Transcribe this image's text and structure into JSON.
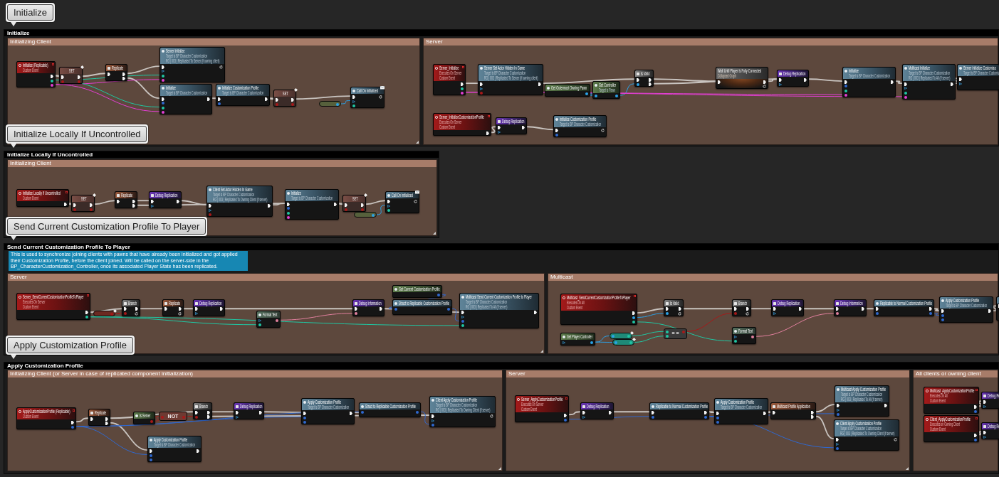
{
  "sections": [
    {
      "bookmark": "Initialize",
      "title": "Initialize",
      "groups": [
        {
          "title": "Initializing Client",
          "nodes": [
            {
              "kind": "event",
              "title": "Initialize (Replicable)",
              "lines": [
                "Custom Event"
              ],
              "out": [
                {
                  "kind": "exec"
                },
                {
                  "kind": "actor"
                },
                {
                  "kind": "string"
                }
              ]
            },
            {
              "kind": "set",
              "title": "SET",
              "replicated": true,
              "in": [
                {
                  "kind": "exec"
                },
                {
                  "kind": "bool"
                }
              ],
              "out": [
                {
                  "kind": "exec"
                },
                {
                  "kind": "bool"
                }
              ]
            },
            {
              "kind": "replicate",
              "title": "Replicate",
              "in": [
                {
                  "kind": "exec"
                }
              ],
              "out": [
                {
                  "kind": "exec"
                },
                {
                  "kind": "exec"
                }
              ]
            },
            {
              "kind": "function",
              "title": "Server Initialize",
              "lines": [
                "Target is BP Character Customization",
                "RG | 003 | Replicated To Server (if owning client)"
              ],
              "in": [
                {
                  "kind": "exec"
                },
                {
                  "kind": "self"
                },
                {
                  "kind": "actor"
                },
                {
                  "kind": "string"
                }
              ],
              "out": [
                {
                  "kind": "latent"
                }
              ]
            },
            {
              "kind": "function",
              "title": "Initialize",
              "lines": [
                "Target is BP Character Customization"
              ],
              "in": [
                {
                  "kind": "exec"
                },
                {
                  "kind": "struct"
                },
                {
                  "kind": "actor"
                },
                {
                  "kind": "string"
                }
              ],
              "out": [
                {
                  "kind": "exec"
                }
              ]
            },
            {
              "kind": "function",
              "title": "Initialize Customization Profile",
              "lines": [
                "Target is BP Character Customization"
              ],
              "in": [
                {
                  "kind": "exec"
                },
                {
                  "kind": "struct"
                }
              ],
              "out": [
                {
                  "kind": "exec"
                }
              ]
            },
            {
              "kind": "set",
              "title": "SET",
              "replicated": true,
              "in": [
                {
                  "kind": "exec"
                },
                {
                  "kind": "bool"
                }
              ],
              "out": [
                {
                  "kind": "exec"
                },
                {
                  "kind": "bool"
                }
              ]
            },
            {
              "kind": "variable",
              "color": "#56603c",
              "replicated": false,
              "out": [
                {
                  "kind": "object"
                }
              ]
            },
            {
              "kind": "dispatch",
              "title": "Call On Initialized",
              "in": [
                {
                  "kind": "exec"
                },
                {
                  "kind": "self"
                },
                {
                  "kind": "actor"
                }
              ],
              "out": [
                {
                  "kind": "latent"
                }
              ]
            }
          ]
        },
        {
          "title": "Server",
          "nodes": [
            {
              "kind": "event",
              "title": "Server_Initialize",
              "lines": [
                "Executes On Server",
                "Custom Event"
              ],
              "out": [
                {
                  "kind": "exec"
                },
                {
                  "kind": "actor"
                },
                {
                  "kind": "string"
                }
              ]
            },
            {
              "kind": "function",
              "title": "Server Set Actor Hidden In Game",
              "lines": [
                "Target is BP Character Customization",
                "RG | 003 | Replicated To Server (if owning client)"
              ],
              "in": [
                {
                  "kind": "exec"
                },
                {
                  "kind": "self"
                },
                {
                  "kind": "bool"
                }
              ],
              "out": [
                {
                  "kind": "exec"
                }
              ]
            },
            {
              "kind": "pure",
              "title": "Get Outermost Owning Pawn",
              "out": [
                {
                  "kind": "object"
                }
              ]
            },
            {
              "kind": "pure",
              "title": "Get Controller",
              "lines": [
                "Target is Pawn"
              ],
              "in": [
                {
                  "kind": "object"
                }
              ],
              "out": [
                {
                  "kind": "object"
                }
              ]
            },
            {
              "kind": "branch",
              "title": "Is Valid",
              "in": [
                {
                  "kind": "exec"
                },
                {
                  "kind": "object"
                }
              ],
              "out": [
                {
                  "kind": "exec"
                },
                {
                  "kind": "exec"
                }
              ]
            },
            {
              "kind": "collapsed",
              "title": "Wait Until Player Is Fully Connected",
              "lines": [
                "Collapsed Graph"
              ],
              "in": [
                {
                  "kind": "exec"
                }
              ],
              "out": [
                {
                  "kind": "exec"
                },
                {
                  "kind": "latent"
                }
              ]
            },
            {
              "kind": "macro",
              "title": "Debug Replication",
              "in": [
                {
                  "kind": "exec"
                },
                {
                  "kind": "self"
                }
              ],
              "out": [
                {
                  "kind": "exec"
                }
              ]
            },
            {
              "kind": "function",
              "title": "Initialize",
              "lines": [
                "Target is BP Character Customization"
              ],
              "in": [
                {
                  "kind": "exec"
                },
                {
                  "kind": "struct"
                },
                {
                  "kind": "actor"
                },
                {
                  "kind": "string"
                }
              ],
              "out": [
                {
                  "kind": "exec"
                }
              ]
            },
            {
              "kind": "function",
              "title": "Multicast Initialize",
              "lines": [
                "Target is BP Character Customization",
                "RG | 003 | Replicated To All (if server)"
              ],
              "in": [
                {
                  "kind": "exec"
                },
                {
                  "kind": "self"
                },
                {
                  "kind": "actor"
                },
                {
                  "kind": "string"
                }
              ],
              "out": [
                {
                  "kind": "exec"
                }
              ]
            },
            {
              "kind": "function",
              "title": "Server Initialize Customiza",
              "lines": [
                "Target is BP Character Customiz"
              ],
              "in": [
                {
                  "kind": "exec"
                },
                {
                  "kind": "self"
                }
              ]
            },
            {
              "kind": "event",
              "title": "Server_InitializeCustomizationProfile",
              "lines": [
                "Executes On Server",
                "Custom Event"
              ],
              "out": [
                {
                  "kind": "exec"
                }
              ]
            },
            {
              "kind": "macro",
              "title": "Debug Replication",
              "in": [
                {
                  "kind": "exec"
                },
                {
                  "kind": "self"
                }
              ],
              "out": [
                {
                  "kind": "exec"
                }
              ]
            },
            {
              "kind": "function",
              "title": "Initialize Customization Profile",
              "lines": [
                "Target is BP Character Customization"
              ],
              "in": [
                {
                  "kind": "exec"
                },
                {
                  "kind": "struct"
                }
              ],
              "out": [
                {
                  "kind": "latent"
                }
              ]
            }
          ]
        }
      ]
    },
    {
      "bookmark": "Initialize Locally If Uncontrolled",
      "title": "Initialize Locally If Uncontrolled",
      "groups": [
        {
          "title": "Initializing Client",
          "nodes": [
            {
              "kind": "event",
              "title": "Initialize Locally If Uncontrolled",
              "lines": [
                "Custom Event"
              ],
              "out": [
                {
                  "kind": "exec"
                }
              ]
            },
            {
              "kind": "set",
              "title": "SET",
              "replicated": true,
              "in": [
                {
                  "kind": "exec"
                },
                {
                  "kind": "bool"
                }
              ],
              "out": [
                {
                  "kind": "exec"
                },
                {
                  "kind": "bool"
                }
              ]
            },
            {
              "kind": "replicate",
              "title": "Replicate",
              "in": [
                {
                  "kind": "exec"
                }
              ],
              "out": [
                {
                  "kind": "exec"
                },
                {
                  "kind": "exec"
                }
              ]
            },
            {
              "kind": "macro",
              "title": "Debug Replication",
              "in": [
                {
                  "kind": "exec"
                },
                {
                  "kind": "self"
                }
              ],
              "out": [
                {
                  "kind": "exec"
                }
              ]
            },
            {
              "kind": "function",
              "title": "Client Set Actor Hidden In Game",
              "lines": [
                "Target is BP Character Customization",
                "RG | 003 | Replicated To Owning Client (if server)"
              ],
              "in": [
                {
                  "kind": "exec"
                },
                {
                  "kind": "self"
                },
                {
                  "kind": "bool"
                }
              ],
              "out": [
                {
                  "kind": "exec"
                }
              ]
            },
            {
              "kind": "function",
              "title": "Initialize",
              "lines": [
                "Target is BP Character Customization"
              ],
              "in": [
                {
                  "kind": "exec"
                },
                {
                  "kind": "struct"
                },
                {
                  "kind": "actor"
                },
                {
                  "kind": "string"
                }
              ],
              "out": [
                {
                  "kind": "exec"
                }
              ]
            },
            {
              "kind": "set",
              "title": "SET",
              "replicated": true,
              "in": [
                {
                  "kind": "exec"
                },
                {
                  "kind": "bool"
                }
              ],
              "out": [
                {
                  "kind": "exec"
                },
                {
                  "kind": "bool"
                }
              ]
            },
            {
              "kind": "variable",
              "color": "#56603c",
              "replicated": false,
              "out": [
                {
                  "kind": "object"
                }
              ]
            },
            {
              "kind": "dispatch",
              "title": "Call On Initialized",
              "in": [
                {
                  "kind": "exec"
                },
                {
                  "kind": "self"
                },
                {
                  "kind": "actor"
                }
              ],
              "out": [
                {
                  "kind": "latent"
                }
              ]
            }
          ]
        }
      ]
    },
    {
      "bookmark": "Send Current Customization Profile To Player",
      "title": "Send Current Customization Profile To Player",
      "note": "This is used to synchronize joining clients with pawns that have already been initialized and got applied their Customization Profile, before the client joined. Will be called on the server-side in the BP_CharacterCustomization_Controller, once its associated Player State has been replicated.",
      "groups": [
        {
          "title": "Server",
          "nodes": [
            {
              "kind": "event",
              "title": "Server_SendCurrentCustomizationProfileToPlayer",
              "lines": [
                "Executes On Server",
                "Custom Event"
              ],
              "out": [
                {
                  "kind": "exec"
                },
                {
                  "kind": "actor"
                }
              ]
            },
            {
              "kind": "variable",
              "color": "#6b2a22",
              "replicated": true,
              "out": [
                {
                  "kind": "bool"
                }
              ]
            },
            {
              "kind": "branch",
              "title": "Branch",
              "in": [
                {
                  "kind": "exec"
                },
                {
                  "kind": "bool"
                }
              ],
              "out": [
                {
                  "kind": "exec"
                },
                {
                  "kind": "latent"
                }
              ]
            },
            {
              "kind": "replicate",
              "title": "Replicate",
              "in": [
                {
                  "kind": "exec"
                }
              ],
              "out": [
                {
                  "kind": "exec"
                },
                {
                  "kind": "latent"
                }
              ]
            },
            {
              "kind": "macro",
              "title": "Debug Replication",
              "in": [
                {
                  "kind": "exec"
                },
                {
                  "kind": "self"
                }
              ],
              "out": [
                {
                  "kind": "exec"
                }
              ]
            },
            {
              "kind": "format",
              "title": "Format Text",
              "in": [
                {
                  "kind": "self"
                },
                {
                  "kind": "actor"
                }
              ],
              "out": [
                {
                  "kind": "text"
                }
              ]
            },
            {
              "kind": "macro",
              "title": "Debug Information",
              "in": [
                {
                  "kind": "exec"
                },
                {
                  "kind": "text"
                }
              ],
              "out": [
                {
                  "kind": "exec"
                }
              ]
            },
            {
              "kind": "pure",
              "title": "Get Current Customization Profile",
              "out": [
                {
                  "kind": "struct"
                }
              ]
            },
            {
              "kind": "function",
              "title": "Struct to Replicable Customization Profile",
              "in": [
                {
                  "kind": "struct"
                }
              ],
              "out": [
                {
                  "kind": "struct"
                }
              ]
            },
            {
              "kind": "function",
              "title": "Multicast Send Current Customization Profile to Player",
              "lines": [
                "Target is BP Character Customization",
                "RG | 003 | Replicated To All (if server)"
              ],
              "in": [
                {
                  "kind": "exec"
                },
                {
                  "kind": "self"
                },
                {
                  "kind": "struct"
                },
                {
                  "kind": "actor"
                }
              ],
              "out": [
                {
                  "kind": "exec"
                }
              ]
            }
          ]
        },
        {
          "title": "Multicast",
          "nodes": [
            {
              "kind": "event",
              "title": "Multicast_SendCurrentCustomizationProfileToPlayer",
              "lines": [
                "Executes On All",
                "Custom Event"
              ],
              "out": [
                {
                  "kind": "exec"
                },
                {
                  "kind": "object"
                },
                {
                  "kind": "actor"
                }
              ]
            },
            {
              "kind": "branch",
              "title": "Is Valid",
              "in": [
                {
                  "kind": "exec"
                },
                {
                  "kind": "object"
                }
              ],
              "out": [
                {
                  "kind": "exec"
                },
                {
                  "kind": "latent"
                }
              ]
            },
            {
              "kind": "branch",
              "title": "Branch",
              "in": [
                {
                  "kind": "exec"
                },
                {
                  "kind": "bool"
                }
              ],
              "out": [
                {
                  "kind": "exec"
                },
                {
                  "kind": "latent"
                }
              ]
            },
            {
              "kind": "macro",
              "title": "Debug Replication",
              "in": [
                {
                  "kind": "exec"
                },
                {
                  "kind": "self"
                }
              ],
              "out": [
                {
                  "kind": "exec"
                }
              ]
            },
            {
              "kind": "macro",
              "title": "Debug Information",
              "in": [
                {
                  "kind": "exec"
                },
                {
                  "kind": "text"
                }
              ],
              "out": [
                {
                  "kind": "exec"
                }
              ]
            },
            {
              "kind": "function",
              "title": "Replicable to Normal Customization Profile",
              "in": [
                {
                  "kind": "exec"
                },
                {
                  "kind": "struct"
                }
              ],
              "out": [
                {
                  "kind": "exec"
                },
                {
                  "kind": "struct"
                }
              ]
            },
            {
              "kind": "function",
              "title": "Apply Customization Profile",
              "lines": [
                "Target is BP Character Customization"
              ],
              "in": [
                {
                  "kind": "exec"
                },
                {
                  "kind": "struct"
                },
                {
                  "kind": "struct"
                }
              ],
              "out": [
                {
                  "kind": "exec"
                }
              ]
            },
            {
              "kind": "pure",
              "title": "Get Player Controller",
              "in": [
                {
                  "kind": "self"
                }
              ],
              "out": [
                {
                  "kind": "object"
                }
              ]
            },
            {
              "kind": "variable",
              "color": "#1f8a78",
              "replicated": true,
              "in": [
                {
                  "kind": "object"
                }
              ],
              "out": [
                {
                  "kind": "actor"
                }
              ]
            },
            {
              "kind": "variable",
              "color": "#1f8a78",
              "replicated": true,
              "in": [
                {
                  "kind": "object"
                }
              ],
              "out": [
                {
                  "kind": "actor"
                }
              ]
            },
            {
              "kind": "compact",
              "title": "= =",
              "color": "#3a3a3a",
              "in": [
                {
                  "kind": "actor"
                },
                {
                  "kind": "actor"
                }
              ],
              "out": [
                {
                  "kind": "bool"
                }
              ]
            },
            {
              "kind": "format",
              "title": "Format Text",
              "in": [
                {
                  "kind": "self"
                },
                {
                  "kind": "actor"
                }
              ],
              "out": [
                {
                  "kind": "text"
                }
              ]
            },
            {
              "kind": "clipped",
              "in": [
                {
                  "kind": "exec"
                }
              ]
            }
          ]
        }
      ]
    },
    {
      "bookmark": "Apply Customization Profile",
      "title": "Apply Customization Profile",
      "groups": [
        {
          "title": "Initializing Client (or Server in case of replicated component initialization)",
          "nodes": [
            {
              "kind": "event",
              "title": "ApplyCustomizationProfile (Replicable)",
              "lines": [
                "Custom Event"
              ],
              "out": [
                {
                  "kind": "exec"
                },
                {
                  "kind": "struct"
                }
              ]
            },
            {
              "kind": "replicate",
              "title": "Replicate",
              "in": [
                {
                  "kind": "exec"
                }
              ],
              "out": [
                {
                  "kind": "exec"
                },
                {
                  "kind": "exec"
                }
              ]
            },
            {
              "kind": "pure",
              "title": "Is Server",
              "out": [
                {
                  "kind": "bool"
                }
              ]
            },
            {
              "kind": "compact",
              "title": "NOT",
              "color": "#6e3a32",
              "in": [
                {
                  "kind": "bool"
                }
              ],
              "out": [
                {
                  "kind": "bool"
                }
              ]
            },
            {
              "kind": "branch",
              "title": "Branch",
              "in": [
                {
                  "kind": "exec"
                },
                {
                  "kind": "bool"
                }
              ],
              "out": [
                {
                  "kind": "exec"
                },
                {
                  "kind": "exec"
                }
              ]
            },
            {
              "kind": "macro",
              "title": "Debug Replication",
              "in": [
                {
                  "kind": "exec"
                },
                {
                  "kind": "self"
                }
              ],
              "out": [
                {
                  "kind": "exec"
                }
              ]
            },
            {
              "kind": "function",
              "title": "Apply Customization Profile",
              "lines": [
                "Target is BP Character Customization"
              ],
              "in": [
                {
                  "kind": "exec"
                },
                {
                  "kind": "struct"
                },
                {
                  "kind": "struct"
                }
              ],
              "out": [
                {
                  "kind": "exec"
                }
              ]
            },
            {
              "kind": "function",
              "title": "Struct to Replicable Customization Profile",
              "in": [
                {
                  "kind": "struct"
                }
              ],
              "out": [
                {
                  "kind": "struct"
                }
              ]
            },
            {
              "kind": "function",
              "title": "Client Apply Customization Profile",
              "lines": [
                "Target is BP Character Customization",
                "RG | 003 | Replicated To Owning Client (if server)"
              ],
              "in": [
                {
                  "kind": "exec"
                },
                {
                  "kind": "self"
                },
                {
                  "kind": "struct"
                }
              ],
              "out": [
                {
                  "kind": "latent"
                }
              ]
            },
            {
              "kind": "function",
              "title": "Apply Customization Profile",
              "lines": [
                "Target is BP Character Customization"
              ],
              "in": [
                {
                  "kind": "exec"
                },
                {
                  "kind": "struct"
                },
                {
                  "kind": "struct"
                }
              ],
              "out": [
                {
                  "kind": "exec"
                }
              ]
            }
          ]
        },
        {
          "title": "Server",
          "nodes": [
            {
              "kind": "event",
              "title": "Server_ApplyCustomizationProfile",
              "lines": [
                "Executes On Server",
                "Custom Event"
              ],
              "out": [
                {
                  "kind": "exec"
                },
                {
                  "kind": "struct"
                }
              ]
            },
            {
              "kind": "macro",
              "title": "Debug Replication",
              "in": [
                {
                  "kind": "exec"
                },
                {
                  "kind": "self"
                }
              ],
              "out": [
                {
                  "kind": "exec"
                }
              ]
            },
            {
              "kind": "function",
              "title": "Replicable to Normal Customization Profile",
              "in": [
                {
                  "kind": "exec"
                },
                {
                  "kind": "struct"
                }
              ],
              "out": [
                {
                  "kind": "exec"
                },
                {
                  "kind": "struct"
                }
              ]
            },
            {
              "kind": "function",
              "title": "Apply Customization Profile",
              "lines": [
                "Target is BP Character Customization"
              ],
              "in": [
                {
                  "kind": "exec"
                },
                {
                  "kind": "struct"
                },
                {
                  "kind": "struct"
                }
              ],
              "out": [
                {
                  "kind": "exec"
                }
              ]
            },
            {
              "kind": "replicate",
              "title": "Multicast Profile Application",
              "in": [
                {
                  "kind": "exec"
                }
              ],
              "out": [
                {
                  "kind": "exec"
                },
                {
                  "kind": "exec"
                }
              ]
            },
            {
              "kind": "function",
              "title": "Multicast Apply Customization Profile",
              "lines": [
                "Target is BP Character Customization",
                "RG | 003 | Replicated To All (if server)"
              ],
              "in": [
                {
                  "kind": "exec"
                },
                {
                  "kind": "self"
                },
                {
                  "kind": "struct"
                }
              ],
              "out": [
                {
                  "kind": "exec"
                }
              ]
            },
            {
              "kind": "function",
              "title": "Client Apply Customization Profile",
              "lines": [
                "Target is BP Character Customization",
                "RG | 003 | Replicated To Owning Client (if server)"
              ],
              "in": [
                {
                  "kind": "exec"
                },
                {
                  "kind": "self"
                },
                {
                  "kind": "struct"
                }
              ],
              "out": [
                {
                  "kind": "latent"
                }
              ]
            }
          ]
        },
        {
          "title": "All clients or owning client",
          "nodes": [
            {
              "kind": "event",
              "title": "Multicast_ApplyCustomizationProfile",
              "lines": [
                "Executes On All",
                "Custom Event"
              ],
              "out": [
                {
                  "kind": "exec"
                },
                {
                  "kind": "struct"
                }
              ]
            },
            {
              "kind": "macro",
              "title": "Debug Re",
              "in": [
                {
                  "kind": "exec"
                },
                {
                  "kind": "self"
                }
              ]
            },
            {
              "kind": "event",
              "title": "Client_ApplyCustomizationProfile",
              "lines": [
                "Executes on Owning Client",
                "Custom Event"
              ],
              "out": [
                {
                  "kind": "exec"
                },
                {
                  "kind": "struct"
                }
              ]
            },
            {
              "kind": "macro",
              "title": "Debug Re",
              "in": [
                {
                  "kind": "exec"
                },
                {
                  "kind": "self"
                }
              ]
            }
          ]
        }
      ]
    }
  ]
}
